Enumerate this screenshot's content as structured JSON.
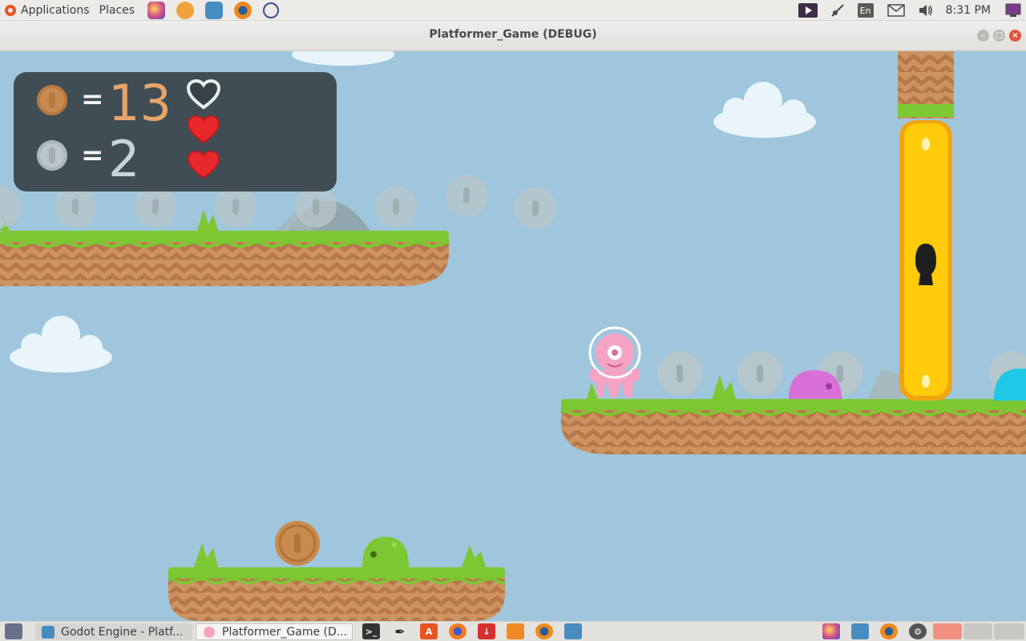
{
  "top_panel": {
    "applications_label": "Applications",
    "places_label": "Places",
    "language": "En",
    "clock": "8:31 PM"
  },
  "window": {
    "title": "Platformer_Game (DEBUG)"
  },
  "hud": {
    "bronze_coin_count": "13",
    "silver_coin_count": "2",
    "equals": "=",
    "hearts": [
      {
        "state": "empty"
      },
      {
        "state": "full"
      },
      {
        "state": "full"
      }
    ]
  },
  "taskbar": {
    "items": [
      {
        "label": "Godot Engine - Platf..."
      },
      {
        "label": "Platformer_Game (D..."
      }
    ]
  },
  "colors": {
    "sky": "#9fc6dc",
    "grass": "#7cc832",
    "dirt": "#cd9461",
    "hud_panel": "#374248",
    "bronze": "#c98a4f",
    "heart_red": "#e8282a",
    "door_yellow": "#ffcb0a"
  }
}
